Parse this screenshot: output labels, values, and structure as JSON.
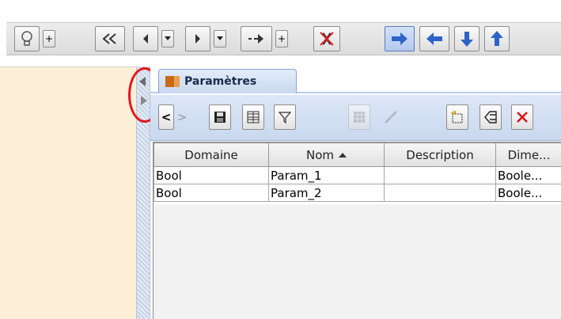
{
  "toolbar": {
    "buttons": [
      {
        "name": "lightbulb-button",
        "icon": "lightbulb-icon"
      },
      {
        "name": "plus-small",
        "label": "+"
      },
      {
        "name": "rewind-button",
        "icon": "double-chevron-left-icon"
      },
      {
        "name": "previous-button",
        "icon": "triangle-left-icon"
      },
      {
        "name": "dropdown",
        "icon": "small-down-arrow-icon"
      },
      {
        "name": "next-button",
        "icon": "triangle-right-icon"
      },
      {
        "name": "dropdown",
        "icon": "small-down-arrow-icon"
      },
      {
        "name": "jump-button",
        "icon": "dash-arrow-right-icon"
      },
      {
        "name": "plus-small",
        "label": "+"
      },
      {
        "name": "cancel-button",
        "icon": "crossed-x-icon"
      },
      {
        "name": "arrow-right-button",
        "icon": "arrow-right-icon"
      },
      {
        "name": "arrow-left-button",
        "icon": "arrow-left-icon"
      },
      {
        "name": "arrow-down-button",
        "icon": "arrow-down-icon"
      },
      {
        "name": "arrow-up-button",
        "icon": "arrow-up-icon"
      }
    ],
    "plus_label": "+",
    "accent_color": "#2f63c8"
  },
  "tab": {
    "label": "Paramètres",
    "icon": "table-folder-icon"
  },
  "inner_toolbar": {
    "nav_prev_label": "<",
    "nav_next_label": ">",
    "buttons": [
      "save-icon",
      "columns-icon",
      "filter-icon",
      "grid-icon",
      "link-icon",
      "new-item-icon",
      "remove-row-icon",
      "delete-icon"
    ]
  },
  "table": {
    "columns": [
      "Domaine",
      "Nom",
      "Description",
      "Dime..."
    ],
    "sorted_column": "Nom",
    "sort_direction": "ascending",
    "rows": [
      [
        "Bool",
        "Param_1",
        "",
        "Boole..."
      ],
      [
        "Bool",
        "Param_2",
        "",
        "Boole..."
      ]
    ]
  },
  "colors": {
    "left_panel": "#fdefd7",
    "highlight_circle": "#e0161b",
    "delete_red": "#d01818"
  }
}
